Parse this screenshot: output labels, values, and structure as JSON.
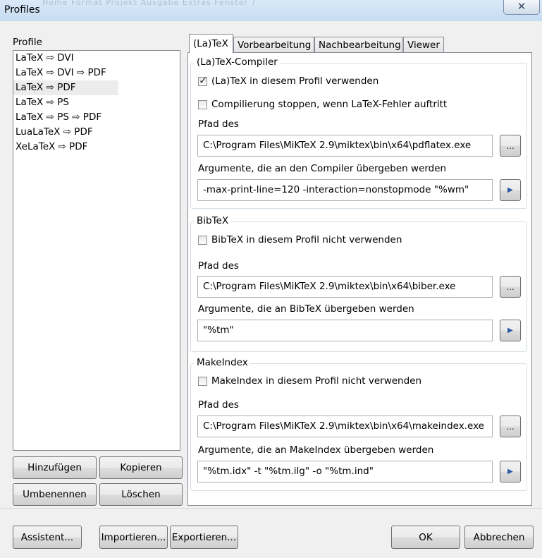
{
  "window": {
    "title": "Profiles",
    "ghost_menu": "Home   Format   Projekt   Ausgabe   Extras   Fenster   ?",
    "close_glyph": "✕"
  },
  "profiles": {
    "label": "Profile",
    "items": [
      "LaTeX ⇨ DVI",
      "LaTeX ⇨ DVI ⇨ PDF",
      "LaTeX ⇨ PDF",
      "LaTeX ⇨ PS",
      "LaTeX ⇨ PS ⇨ PDF",
      "LuaLaTeX ⇨ PDF",
      "XeLaTeX ⇨ PDF"
    ],
    "selected_index": 2,
    "buttons": {
      "add": "Hinzufügen",
      "copy": "Kopieren",
      "rename": "Umbenennen",
      "delete": "Löschen"
    }
  },
  "tabs": [
    {
      "label": "(La)TeX",
      "active": true
    },
    {
      "label": "Vorbearbeitung",
      "active": false
    },
    {
      "label": "Nachbearbeitung",
      "active": false
    },
    {
      "label": "Viewer",
      "active": false
    }
  ],
  "compiler": {
    "title": "(La)TeX-Compiler",
    "use_label": "(La)TeX in diesem Profil verwenden",
    "use_checked": true,
    "stop_label": "Compilierung stoppen, wenn LaTeX-Fehler auftritt",
    "stop_checked": false,
    "path_label": "Pfad des",
    "path_value": "C:\\Program Files\\MiKTeX 2.9\\miktex\\bin\\x64\\pdflatex.exe",
    "args_label": "Argumente, die an den Compiler übergeben werden",
    "args_value": "-max-print-line=120 -interaction=nonstopmode \"%wm\""
  },
  "bibtex": {
    "title": "BibTeX",
    "disable_label": "BibTeX in diesem Profil nicht verwenden",
    "disable_checked": false,
    "path_label": "Pfad des",
    "path_value": "C:\\Program Files\\MiKTeX 2.9\\miktex\\bin\\x64\\biber.exe",
    "args_label": "Argumente, die an BibTeX übergeben werden",
    "args_value": "\"%tm\""
  },
  "makeindex": {
    "title": "MakeIndex",
    "disable_label": "MakeIndex in diesem Profil nicht verwenden",
    "disable_checked": false,
    "path_label": "Pfad des",
    "path_value": "C:\\Program Files\\MiKTeX 2.9\\miktex\\bin\\x64\\makeindex.exe",
    "args_label": "Argumente, die an MakeIndex übergeben werden",
    "args_value": "\"%tm.idx\" -t \"%tm.ilg\" -o \"%tm.ind\""
  },
  "browse_glyph": "...",
  "arrow_glyph": "▶",
  "checkmark_glyph": "✓",
  "footer": {
    "wizard": "Assistent...",
    "import": "Importieren...",
    "export": "Exportieren...",
    "ok": "OK",
    "cancel": "Abbrechen"
  }
}
